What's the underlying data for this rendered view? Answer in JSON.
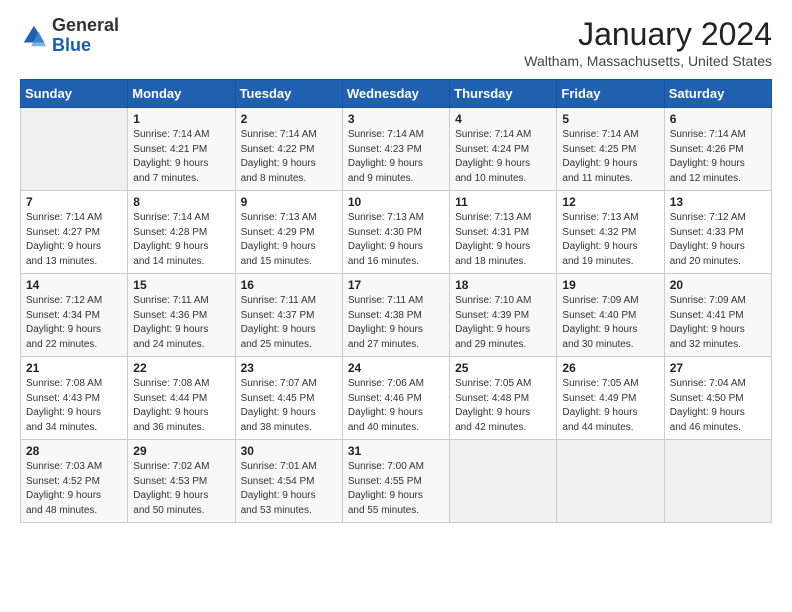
{
  "header": {
    "logo_line1": "General",
    "logo_line2": "Blue",
    "month": "January 2024",
    "location": "Waltham, Massachusetts, United States"
  },
  "weekdays": [
    "Sunday",
    "Monday",
    "Tuesday",
    "Wednesday",
    "Thursday",
    "Friday",
    "Saturday"
  ],
  "weeks": [
    [
      {
        "day": "",
        "info": ""
      },
      {
        "day": "1",
        "info": "Sunrise: 7:14 AM\nSunset: 4:21 PM\nDaylight: 9 hours\nand 7 minutes."
      },
      {
        "day": "2",
        "info": "Sunrise: 7:14 AM\nSunset: 4:22 PM\nDaylight: 9 hours\nand 8 minutes."
      },
      {
        "day": "3",
        "info": "Sunrise: 7:14 AM\nSunset: 4:23 PM\nDaylight: 9 hours\nand 9 minutes."
      },
      {
        "day": "4",
        "info": "Sunrise: 7:14 AM\nSunset: 4:24 PM\nDaylight: 9 hours\nand 10 minutes."
      },
      {
        "day": "5",
        "info": "Sunrise: 7:14 AM\nSunset: 4:25 PM\nDaylight: 9 hours\nand 11 minutes."
      },
      {
        "day": "6",
        "info": "Sunrise: 7:14 AM\nSunset: 4:26 PM\nDaylight: 9 hours\nand 12 minutes."
      }
    ],
    [
      {
        "day": "7",
        "info": "Sunrise: 7:14 AM\nSunset: 4:27 PM\nDaylight: 9 hours\nand 13 minutes."
      },
      {
        "day": "8",
        "info": "Sunrise: 7:14 AM\nSunset: 4:28 PM\nDaylight: 9 hours\nand 14 minutes."
      },
      {
        "day": "9",
        "info": "Sunrise: 7:13 AM\nSunset: 4:29 PM\nDaylight: 9 hours\nand 15 minutes."
      },
      {
        "day": "10",
        "info": "Sunrise: 7:13 AM\nSunset: 4:30 PM\nDaylight: 9 hours\nand 16 minutes."
      },
      {
        "day": "11",
        "info": "Sunrise: 7:13 AM\nSunset: 4:31 PM\nDaylight: 9 hours\nand 18 minutes."
      },
      {
        "day": "12",
        "info": "Sunrise: 7:13 AM\nSunset: 4:32 PM\nDaylight: 9 hours\nand 19 minutes."
      },
      {
        "day": "13",
        "info": "Sunrise: 7:12 AM\nSunset: 4:33 PM\nDaylight: 9 hours\nand 20 minutes."
      }
    ],
    [
      {
        "day": "14",
        "info": "Sunrise: 7:12 AM\nSunset: 4:34 PM\nDaylight: 9 hours\nand 22 minutes."
      },
      {
        "day": "15",
        "info": "Sunrise: 7:11 AM\nSunset: 4:36 PM\nDaylight: 9 hours\nand 24 minutes."
      },
      {
        "day": "16",
        "info": "Sunrise: 7:11 AM\nSunset: 4:37 PM\nDaylight: 9 hours\nand 25 minutes."
      },
      {
        "day": "17",
        "info": "Sunrise: 7:11 AM\nSunset: 4:38 PM\nDaylight: 9 hours\nand 27 minutes."
      },
      {
        "day": "18",
        "info": "Sunrise: 7:10 AM\nSunset: 4:39 PM\nDaylight: 9 hours\nand 29 minutes."
      },
      {
        "day": "19",
        "info": "Sunrise: 7:09 AM\nSunset: 4:40 PM\nDaylight: 9 hours\nand 30 minutes."
      },
      {
        "day": "20",
        "info": "Sunrise: 7:09 AM\nSunset: 4:41 PM\nDaylight: 9 hours\nand 32 minutes."
      }
    ],
    [
      {
        "day": "21",
        "info": "Sunrise: 7:08 AM\nSunset: 4:43 PM\nDaylight: 9 hours\nand 34 minutes."
      },
      {
        "day": "22",
        "info": "Sunrise: 7:08 AM\nSunset: 4:44 PM\nDaylight: 9 hours\nand 36 minutes."
      },
      {
        "day": "23",
        "info": "Sunrise: 7:07 AM\nSunset: 4:45 PM\nDaylight: 9 hours\nand 38 minutes."
      },
      {
        "day": "24",
        "info": "Sunrise: 7:06 AM\nSunset: 4:46 PM\nDaylight: 9 hours\nand 40 minutes."
      },
      {
        "day": "25",
        "info": "Sunrise: 7:05 AM\nSunset: 4:48 PM\nDaylight: 9 hours\nand 42 minutes."
      },
      {
        "day": "26",
        "info": "Sunrise: 7:05 AM\nSunset: 4:49 PM\nDaylight: 9 hours\nand 44 minutes."
      },
      {
        "day": "27",
        "info": "Sunrise: 7:04 AM\nSunset: 4:50 PM\nDaylight: 9 hours\nand 46 minutes."
      }
    ],
    [
      {
        "day": "28",
        "info": "Sunrise: 7:03 AM\nSunset: 4:52 PM\nDaylight: 9 hours\nand 48 minutes."
      },
      {
        "day": "29",
        "info": "Sunrise: 7:02 AM\nSunset: 4:53 PM\nDaylight: 9 hours\nand 50 minutes."
      },
      {
        "day": "30",
        "info": "Sunrise: 7:01 AM\nSunset: 4:54 PM\nDaylight: 9 hours\nand 53 minutes."
      },
      {
        "day": "31",
        "info": "Sunrise: 7:00 AM\nSunset: 4:55 PM\nDaylight: 9 hours\nand 55 minutes."
      },
      {
        "day": "",
        "info": ""
      },
      {
        "day": "",
        "info": ""
      },
      {
        "day": "",
        "info": ""
      }
    ]
  ]
}
